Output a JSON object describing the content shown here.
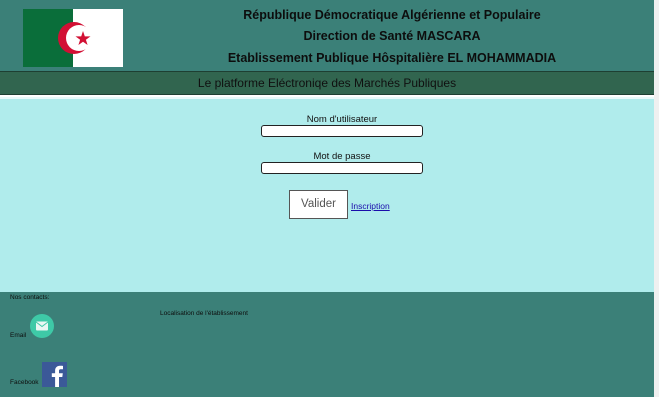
{
  "header": {
    "line1": "République Démocratique Algérienne et Populaire",
    "line2": "Direction de Santé MASCARA",
    "line3": "Etablissement Publique Hôspitalière EL MOHAMMADIA",
    "flag_icon": "algeria-flag-icon"
  },
  "subtitle": "Le platforme Eléctroniqe des Marchés Publiques",
  "login": {
    "username_label": "Nom d'utilisateur",
    "username_value": "",
    "password_label": "Mot de passe",
    "password_value": "",
    "submit_label": "Valider",
    "register_link": "Inscription"
  },
  "footer": {
    "contacts_label": "Nos contacts:",
    "localisation_label": "Localisation de l'établissement",
    "email_label": "Email",
    "email_icon": "email-icon",
    "facebook_label": "Facebook",
    "facebook_icon": "facebook-icon"
  },
  "colors": {
    "header_bg": "#3b8078",
    "subbar_bg": "#31654f",
    "main_bg": "#b0ecec",
    "footer_bg": "#3b8078",
    "link": "#1a0dab"
  }
}
